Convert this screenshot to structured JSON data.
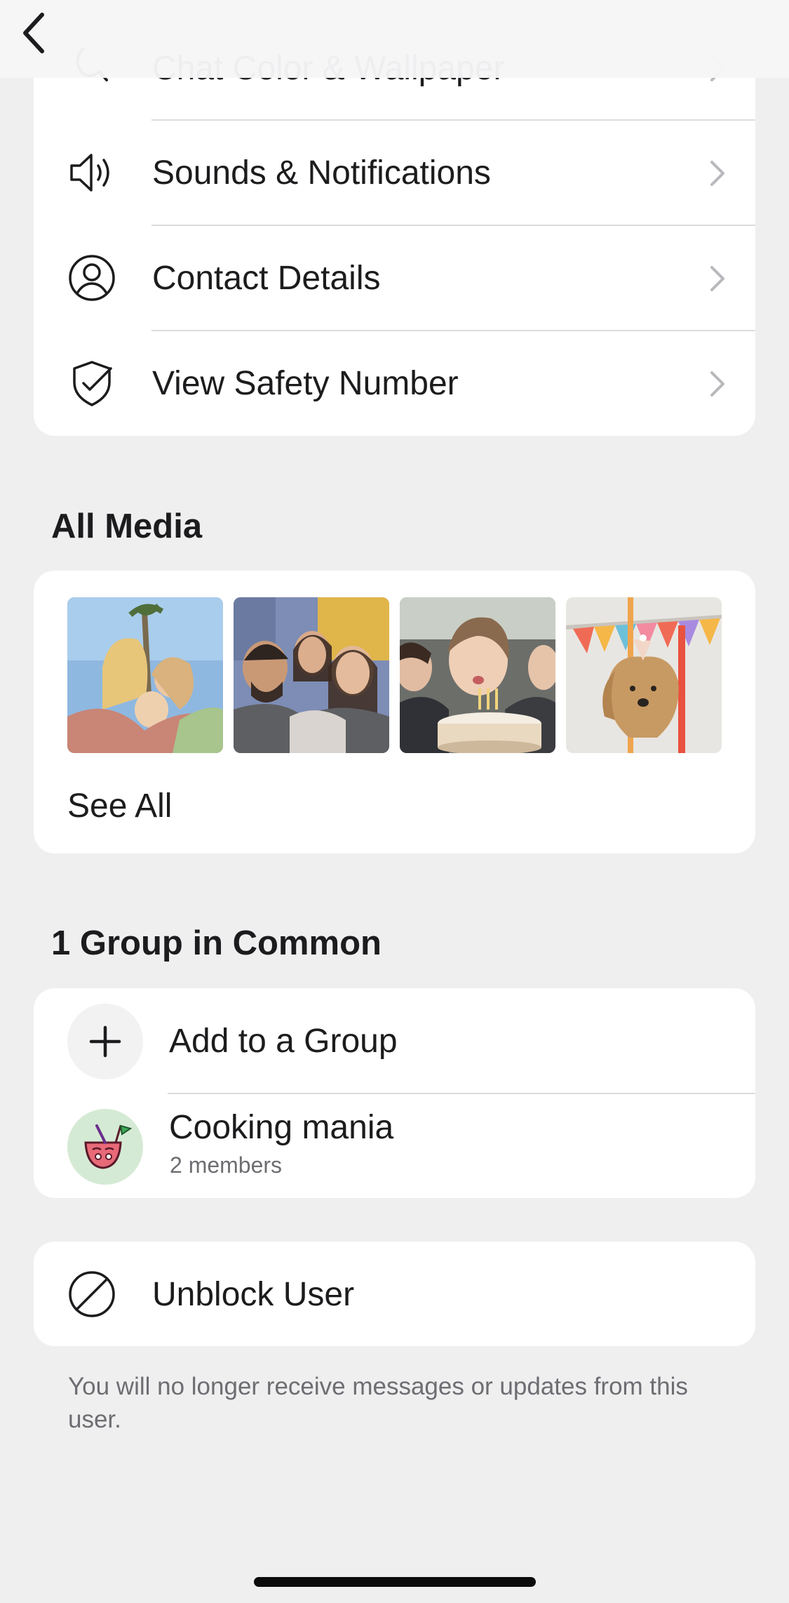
{
  "settings_rows": [
    {
      "label": "Chat Color & Wallpaper",
      "icon": "paint-bucket-icon"
    },
    {
      "label": "Sounds & Notifications",
      "icon": "speaker-icon"
    },
    {
      "label": "Contact Details",
      "icon": "person-circle-icon"
    },
    {
      "label": "View Safety Number",
      "icon": "shield-check-icon"
    }
  ],
  "all_media": {
    "title": "All Media",
    "thumbnails": [
      {
        "alt": "three women under palm tree"
      },
      {
        "alt": "group selfie of friends"
      },
      {
        "alt": "girl blowing birthday candles"
      },
      {
        "alt": "dog in party hat with bunting"
      }
    ],
    "see_all_label": "See All"
  },
  "groups": {
    "title": "1 Group in Common",
    "add_label": "Add to a Group",
    "items": [
      {
        "name": "Cooking mania",
        "members": "2 members",
        "avatar_color": "#d5ead4"
      }
    ]
  },
  "block": {
    "label": "Unblock User",
    "note": "You will no longer receive messages or updates from this user."
  },
  "colors": {
    "background": "#efeff0",
    "card": "#ffffff",
    "text": "#1c1c1e",
    "secondary_text": "#6d6d72",
    "chevron": "#b8b8bd"
  }
}
